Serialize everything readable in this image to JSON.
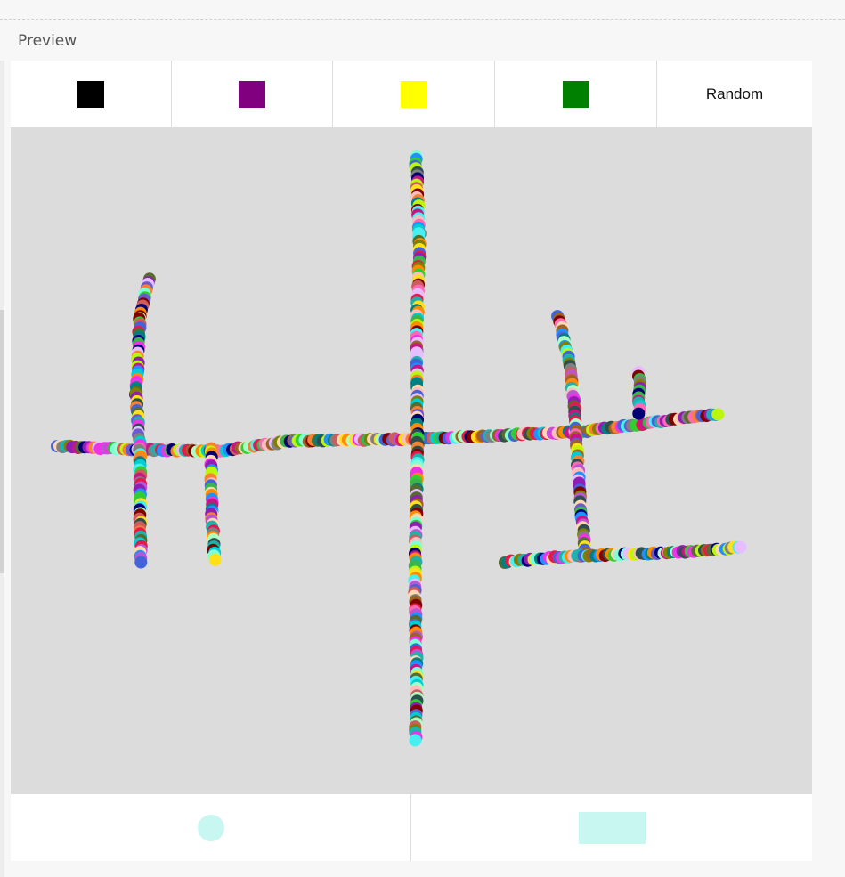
{
  "section": {
    "title": "Preview"
  },
  "toolbar": {
    "colors": [
      {
        "name": "black",
        "hex": "#000000"
      },
      {
        "name": "purple",
        "hex": "#800080"
      },
      {
        "name": "yellow",
        "hex": "#ffff00"
      },
      {
        "name": "green",
        "hex": "#008000"
      }
    ],
    "random_label": "Random"
  },
  "canvas": {
    "background": "#dcdcdc"
  },
  "shapes": [
    {
      "name": "circle",
      "color": "#c8f6f1"
    },
    {
      "name": "rectangle",
      "color": "#c8f6f1"
    }
  ],
  "palette": [
    "#e6194b",
    "#3cb44b",
    "#ffe119",
    "#4363d8",
    "#f58231",
    "#911eb4",
    "#46f0f0",
    "#f032e6",
    "#bcf60c",
    "#fabebe",
    "#008080",
    "#e6beff",
    "#9a6324",
    "#800000",
    "#aaffc3",
    "#808000",
    "#ffd8b1",
    "#000075",
    "#808080",
    "#2f4f4f",
    "#7fffd4",
    "#ff69b4",
    "#1e90ff",
    "#32cd32",
    "#ba55d3",
    "#20b2aa",
    "#cd5c5c",
    "#6a5acd",
    "#00ced1",
    "#ff8c00",
    "#556b2f",
    "#c71585"
  ]
}
